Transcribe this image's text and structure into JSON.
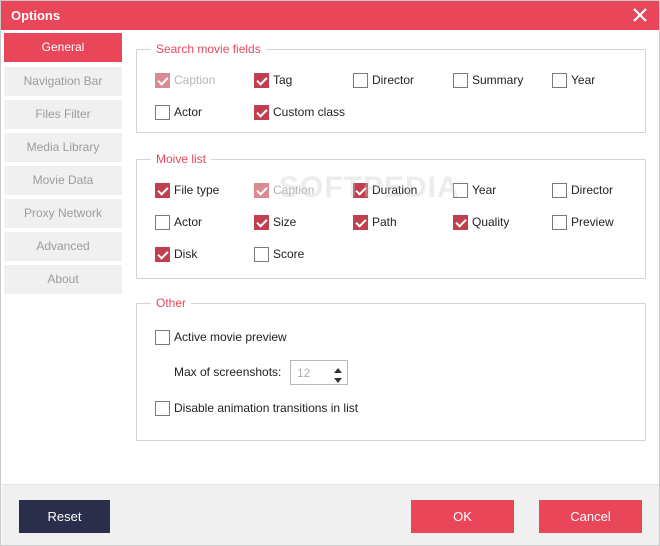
{
  "window": {
    "title": "Options"
  },
  "sidebar": {
    "items": [
      {
        "label": "General",
        "active": true
      },
      {
        "label": "Navigation Bar"
      },
      {
        "label": "Files Filter"
      },
      {
        "label": "Media Library"
      },
      {
        "label": "Movie Data"
      },
      {
        "label": "Proxy Network"
      },
      {
        "label": "Advanced"
      },
      {
        "label": "About"
      }
    ]
  },
  "search_fields": {
    "title": "Search movie fields",
    "options": [
      {
        "label": "Caption",
        "checked": true,
        "disabled": true
      },
      {
        "label": "Tag",
        "checked": true
      },
      {
        "label": "Director",
        "checked": false
      },
      {
        "label": "Summary",
        "checked": false
      },
      {
        "label": "Year",
        "checked": false
      },
      {
        "label": "Actor",
        "checked": false
      },
      {
        "label": "Custom class",
        "checked": true
      }
    ]
  },
  "movie_list": {
    "title": "Moive list",
    "options": [
      {
        "label": "File type",
        "checked": true
      },
      {
        "label": "Caption",
        "checked": true,
        "disabled": true
      },
      {
        "label": "Duration",
        "checked": true
      },
      {
        "label": "Year",
        "checked": false
      },
      {
        "label": "Director",
        "checked": false
      },
      {
        "label": "Actor",
        "checked": false
      },
      {
        "label": "Size",
        "checked": true
      },
      {
        "label": "Path",
        "checked": true
      },
      {
        "label": "Quality",
        "checked": true
      },
      {
        "label": "Preview",
        "checked": false
      },
      {
        "label": "Disk",
        "checked": true
      },
      {
        "label": "Score",
        "checked": false
      }
    ]
  },
  "other": {
    "title": "Other",
    "active_preview": {
      "label": "Active movie preview",
      "checked": false
    },
    "max_screenshots": {
      "label": "Max of screenshots:",
      "value": "12"
    },
    "disable_animation": {
      "label": "Disable animation transitions in list",
      "checked": false
    }
  },
  "footer": {
    "reset_label": "Reset",
    "ok_label": "OK",
    "cancel_label": "Cancel"
  },
  "watermark": "SOFTPEDIA",
  "colors": {
    "accent": "#e9465a",
    "dark_button": "#2b2e4a",
    "checkbox": "#c0404f"
  }
}
